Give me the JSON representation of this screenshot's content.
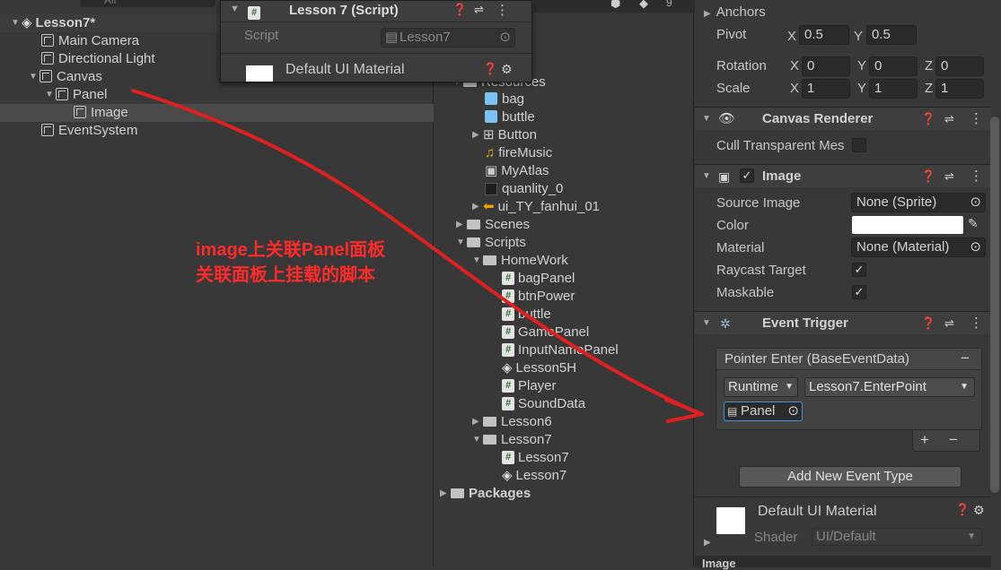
{
  "hierarchy": {
    "search_placeholder": "All",
    "scene": "Lesson7*",
    "items": [
      {
        "label": "Main Camera"
      },
      {
        "label": "Directional Light"
      },
      {
        "label": "Canvas"
      },
      {
        "label": "Panel"
      },
      {
        "label": "Image"
      },
      {
        "label": "EventSystem"
      }
    ]
  },
  "popup": {
    "title": "Lesson 7 (Script)",
    "script_label": "Script",
    "script_value": "Lesson7",
    "material": "Default UI Material"
  },
  "project": {
    "items": [
      {
        "label": "Resources"
      },
      {
        "label": "bag"
      },
      {
        "label": "buttle"
      },
      {
        "label": "Button"
      },
      {
        "label": "fireMusic"
      },
      {
        "label": "MyAtlas"
      },
      {
        "label": "quanlity_0"
      },
      {
        "label": "ui_TY_fanhui_01"
      },
      {
        "label": "Scenes"
      },
      {
        "label": "Scripts"
      },
      {
        "label": "HomeWork"
      },
      {
        "label": "bagPanel"
      },
      {
        "label": "btnPower"
      },
      {
        "label": "buttle"
      },
      {
        "label": "GamePanel"
      },
      {
        "label": "InputNamePanel"
      },
      {
        "label": "Lesson5H"
      },
      {
        "label": "Player"
      },
      {
        "label": "SoundData"
      },
      {
        "label": "Lesson6"
      },
      {
        "label": "Lesson7"
      },
      {
        "label": "Lesson7"
      },
      {
        "label": "Lesson7"
      },
      {
        "label": "Packages"
      }
    ],
    "toolbar_count": "9"
  },
  "inspector": {
    "anchors": "Anchors",
    "pivot": {
      "label": "Pivot",
      "x_label": "X",
      "x": "0.5",
      "y_label": "Y",
      "y": "0.5"
    },
    "rotation": {
      "label": "Rotation",
      "x_label": "X",
      "x": "0",
      "y_label": "Y",
      "y": "0",
      "z_label": "Z",
      "z": "0"
    },
    "scale": {
      "label": "Scale",
      "x_label": "X",
      "x": "1",
      "y_label": "Y",
      "y": "1",
      "z_label": "Z",
      "z": "1"
    },
    "canvas_renderer": {
      "title": "Canvas Renderer",
      "cull_label": "Cull Transparent Mes"
    },
    "image": {
      "title": "Image",
      "source_image_label": "Source Image",
      "source_image": "None (Sprite)",
      "color_label": "Color",
      "material_label": "Material",
      "material": "None (Material)",
      "raycast_label": "Raycast Target",
      "maskable_label": "Maskable"
    },
    "event_trigger": {
      "title": "Event Trigger",
      "entry": "Pointer Enter (BaseEventData)",
      "minus": "−",
      "runtime": "Runtime",
      "function": "Lesson7.EnterPoint",
      "object": "Panel",
      "plus": "+",
      "minus2": "−",
      "add_button": "Add New Event Type"
    },
    "material": {
      "title": "Default UI Material",
      "shader_label": "Shader",
      "shader": "UI/Default"
    },
    "bottom_tab": "Image"
  },
  "annotation": {
    "line1": "image上关联Panel面板",
    "line2": "关联面板上挂载的脚本",
    "color": "#ff2a2a"
  }
}
